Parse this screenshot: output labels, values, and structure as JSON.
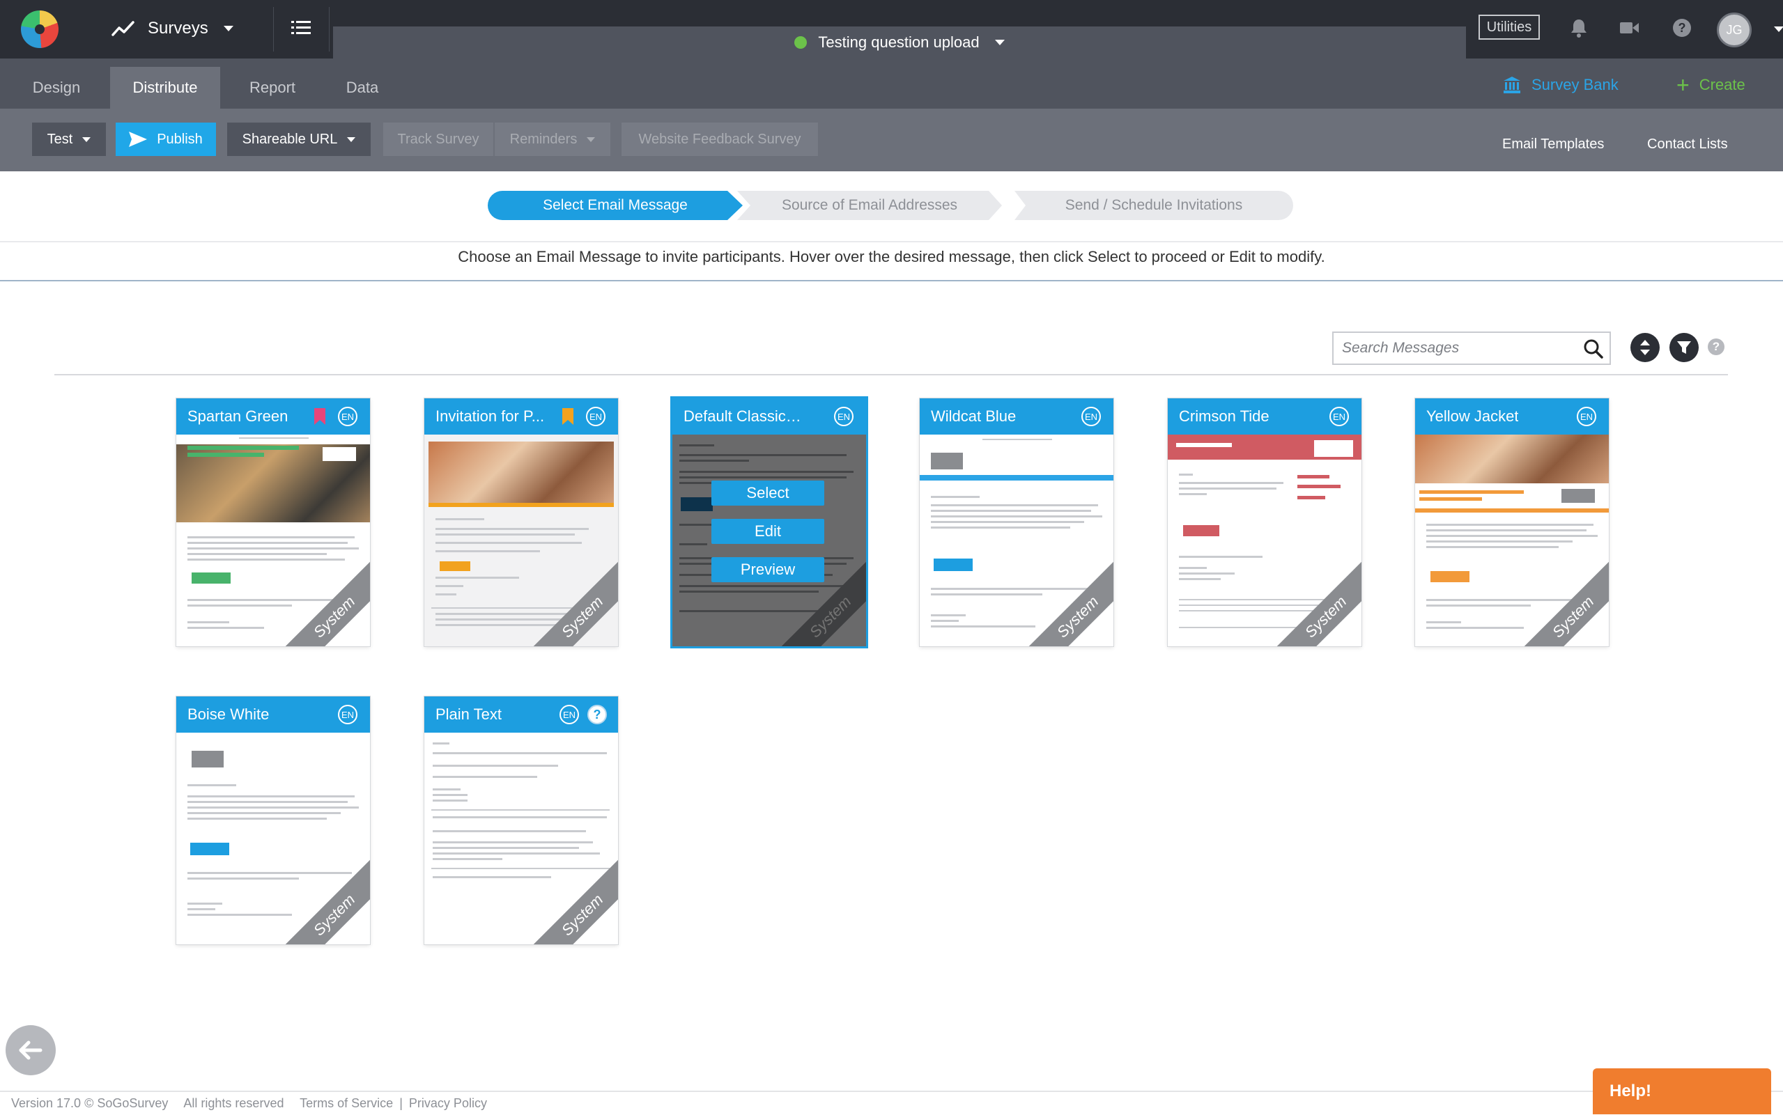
{
  "topbar": {
    "module_label": "Surveys",
    "project_title": "Testing question upload",
    "utilities_label": "Utilities",
    "avatar_initials": "JG"
  },
  "tabs": [
    {
      "label": "Design",
      "active": false
    },
    {
      "label": "Distribute",
      "active": true
    },
    {
      "label": "Report",
      "active": false
    },
    {
      "label": "Data",
      "active": false
    }
  ],
  "tabbar_right": {
    "survey_bank_label": "Survey Bank",
    "create_label": "Create"
  },
  "toolbar": {
    "test_label": "Test",
    "publish_label": "Publish",
    "shareable_url_label": "Shareable URL",
    "track_survey_label": "Track Survey",
    "reminders_label": "Reminders",
    "website_feedback_label": "Website Feedback Survey",
    "email_templates_label": "Email Templates",
    "contact_lists_label": "Contact Lists"
  },
  "stepper": {
    "steps": [
      {
        "label": "Select Email Message",
        "active": true
      },
      {
        "label": "Source of Email Addresses",
        "active": false
      },
      {
        "label": "Send / Schedule Invitations",
        "active": false
      }
    ]
  },
  "instructions": "Choose an Email Message to invite participants. Hover over the desired message, then click Select to proceed or Edit to modify.",
  "search": {
    "placeholder": "Search Messages",
    "value": ""
  },
  "hover_actions": {
    "select_label": "Select",
    "edit_label": "Edit",
    "preview_label": "Preview"
  },
  "templates": [
    {
      "title": "Spartan Green",
      "language": "EN",
      "bookmark": "pink",
      "badge": "System"
    },
    {
      "title": "Invitation for P...",
      "language": "EN",
      "bookmark": "orange",
      "badge": "System"
    },
    {
      "title": "Default Classic Sy...",
      "language": "EN",
      "bookmark": "",
      "badge": "System",
      "hovered": true
    },
    {
      "title": "Wildcat Blue",
      "language": "EN",
      "bookmark": "",
      "badge": "System"
    },
    {
      "title": "Crimson Tide",
      "language": "EN",
      "bookmark": "",
      "badge": "System"
    },
    {
      "title": "Yellow Jacket",
      "language": "EN",
      "bookmark": "",
      "badge": "System"
    },
    {
      "title": "Boise White",
      "language": "EN",
      "bookmark": "",
      "badge": "System"
    },
    {
      "title": "Plain Text",
      "language": "EN",
      "bookmark": "",
      "badge": "System",
      "info_icon": "?"
    }
  ],
  "footer": {
    "version": "Version 17.0 © SoGoSurvey",
    "rights": "All rights reserved",
    "terms": "Terms of Service",
    "separator": "|",
    "privacy": "Privacy Policy"
  },
  "help_widget_label": "Help!",
  "colors": {
    "topbar": "#2b2e35",
    "tabbar": "#50545e",
    "toolbar": "#6c707a",
    "accent_blue": "#1d9ee0",
    "create_green": "#6cc24a",
    "help_orange": "#f07d2e"
  },
  "icons": [
    "logo-icon",
    "trend-icon",
    "list-icon",
    "bell-icon",
    "video-icon",
    "help-icon",
    "bank-icon",
    "plus-icon",
    "send-icon",
    "search-icon",
    "sort-icon",
    "filter-icon",
    "back-arrow-icon"
  ]
}
